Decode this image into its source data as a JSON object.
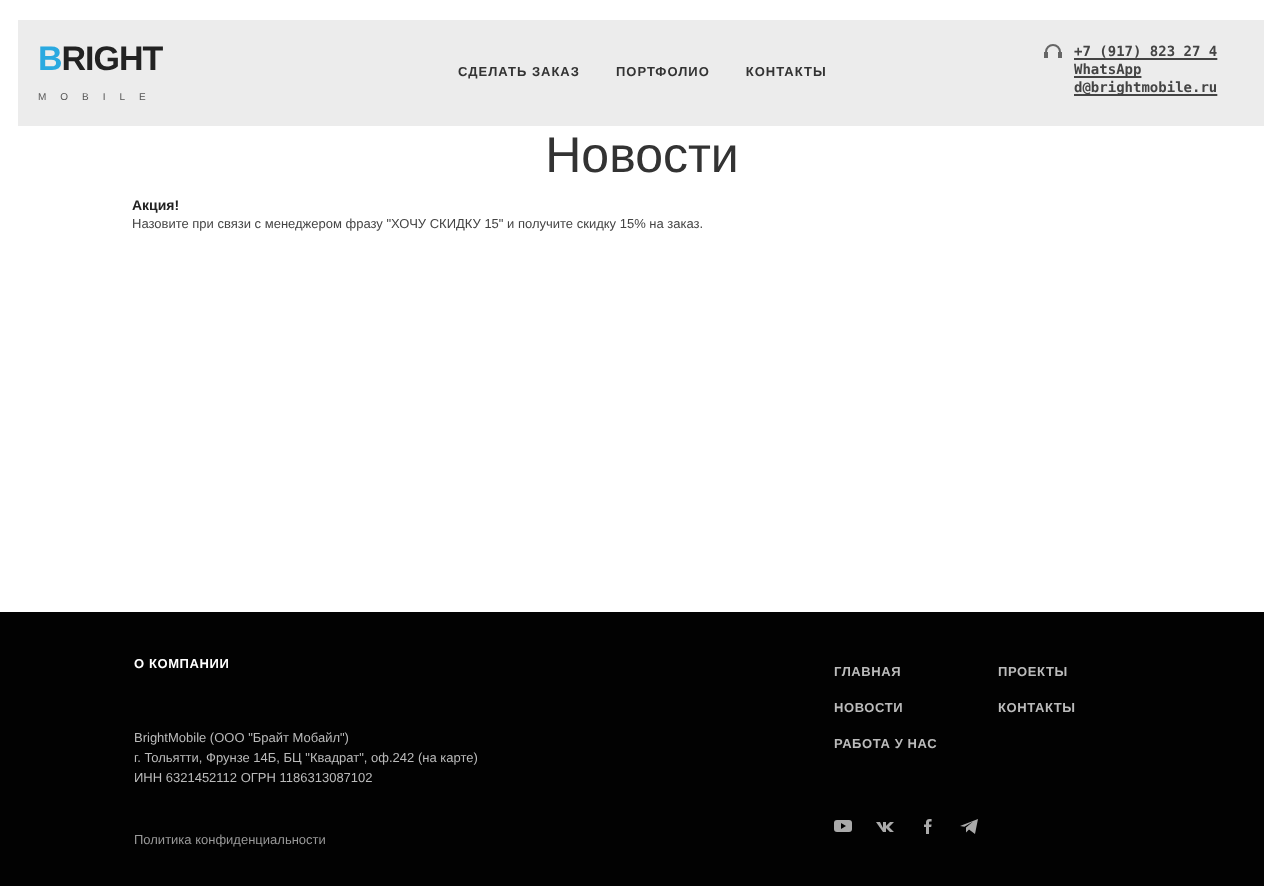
{
  "header": {
    "logo": {
      "title": "BRIGHT",
      "subtitle": "MOBILE"
    },
    "nav": [
      "СДЕЛАТЬ ЗАКАЗ",
      "ПОРТФОЛИО",
      "КОНТАКТЫ"
    ],
    "contacts": {
      "phone": "+7 (917) 823 27 4",
      "whatsapp": "WhatsApp",
      "email": "d@brightmobile.ru"
    }
  },
  "page": {
    "title": "Новости",
    "news": [
      {
        "heading": "Акция!",
        "text": "Назовите при связи с менеджером фразу \"ХОЧУ СКИДКУ 15\" и получите скидку 15% на заказ."
      }
    ]
  },
  "footer": {
    "section_title": "О КОМПАНИИ",
    "company": "BrightMobile (ООО \"Брайт Мобайл\")",
    "address": "г. Тольятти, Фрунзе 14Б, БЦ \"Квадрат\", оф.242 (",
    "map_link": "на карте",
    "address_end": ")",
    "ids": "ИНН 6321452112 ОГРН 1186313087102",
    "privacy": "Политика конфиденциальности",
    "links": [
      "ГЛАВНАЯ",
      "ПРОЕКТЫ",
      "НОВОСТИ",
      "КОНТАКТЫ",
      "РАБОТА У НАС"
    ],
    "socials": [
      {
        "kind": "youtube"
      },
      {
        "kind": "vk"
      },
      {
        "kind": "facebook"
      },
      {
        "kind": "telegram"
      }
    ]
  }
}
